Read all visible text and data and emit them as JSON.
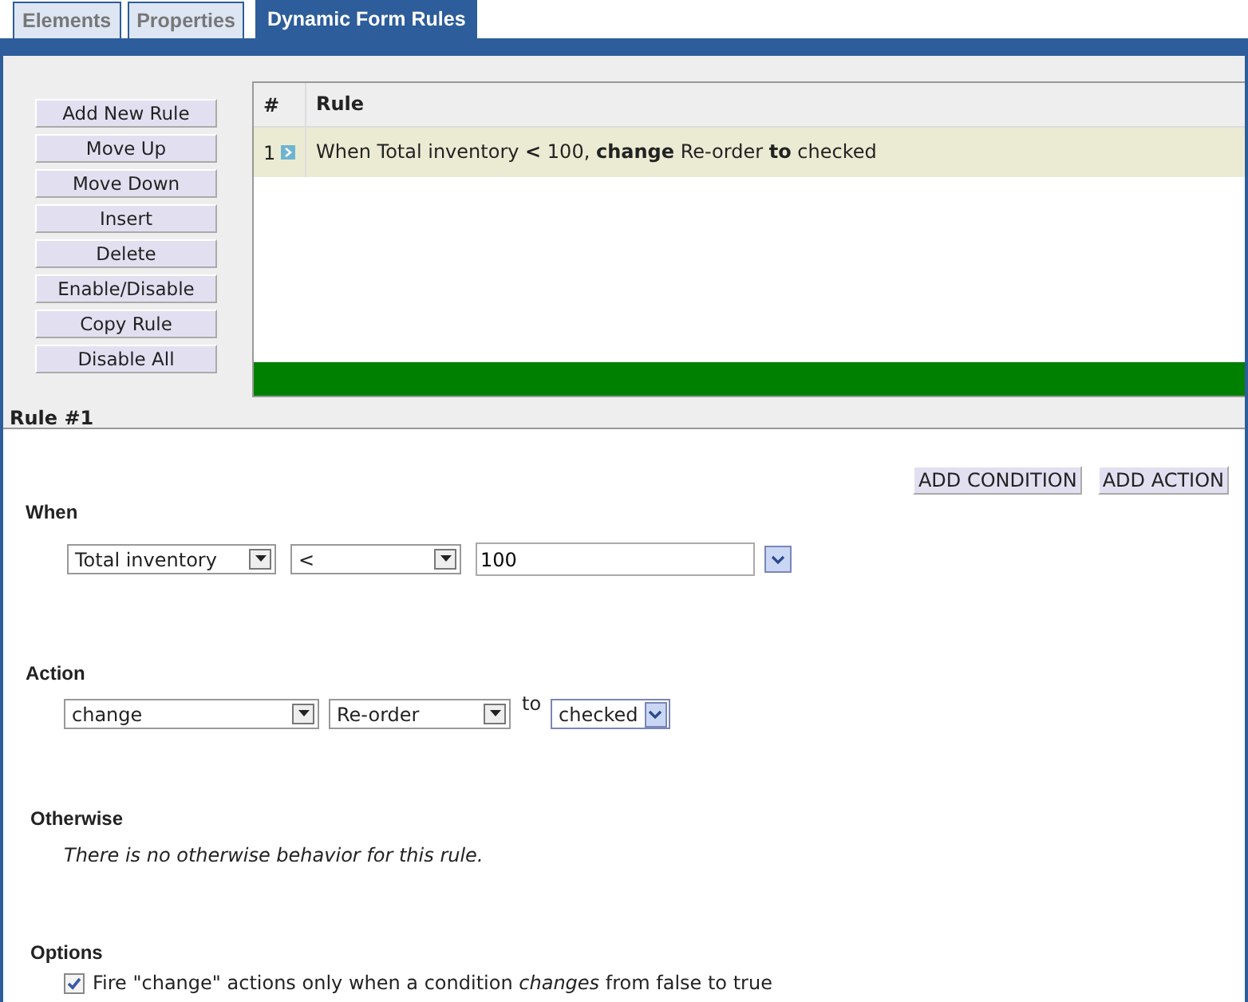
{
  "tabs": [
    {
      "label": "Elements",
      "selected": false
    },
    {
      "label": "Properties",
      "selected": false
    },
    {
      "label": "Dynamic Form Rules",
      "selected": true
    }
  ],
  "rule_buttons": [
    "Add New Rule",
    "Move Up",
    "Move Down",
    "Insert",
    "Delete",
    "Enable/Disable",
    "Copy Rule",
    "Disable All"
  ],
  "rules_table": {
    "columns": [
      "#",
      "Rule"
    ],
    "rows": [
      {
        "number": "1",
        "rule": "When Total inventory **<** 100, **change** Re-order **to** checked",
        "selected": true
      }
    ]
  },
  "rule_title": "Rule #1",
  "editor_buttons": [
    "ADD CONDITION",
    "ADD ACTION"
  ],
  "when": {
    "heading": "When",
    "field": "Total inventory",
    "operator": "<",
    "value": "100"
  },
  "action": {
    "heading": "Action",
    "verb": "change",
    "target": "Re-order",
    "connector": "to",
    "value": "checked"
  },
  "otherwise": {
    "heading": "Otherwise",
    "note": "There is no otherwise behavior for this rule."
  },
  "options": {
    "heading": "Options",
    "items": [
      {
        "label": "Fire \"change\" actions only when a condition *changes* from false to true",
        "checked": true
      }
    ]
  }
}
